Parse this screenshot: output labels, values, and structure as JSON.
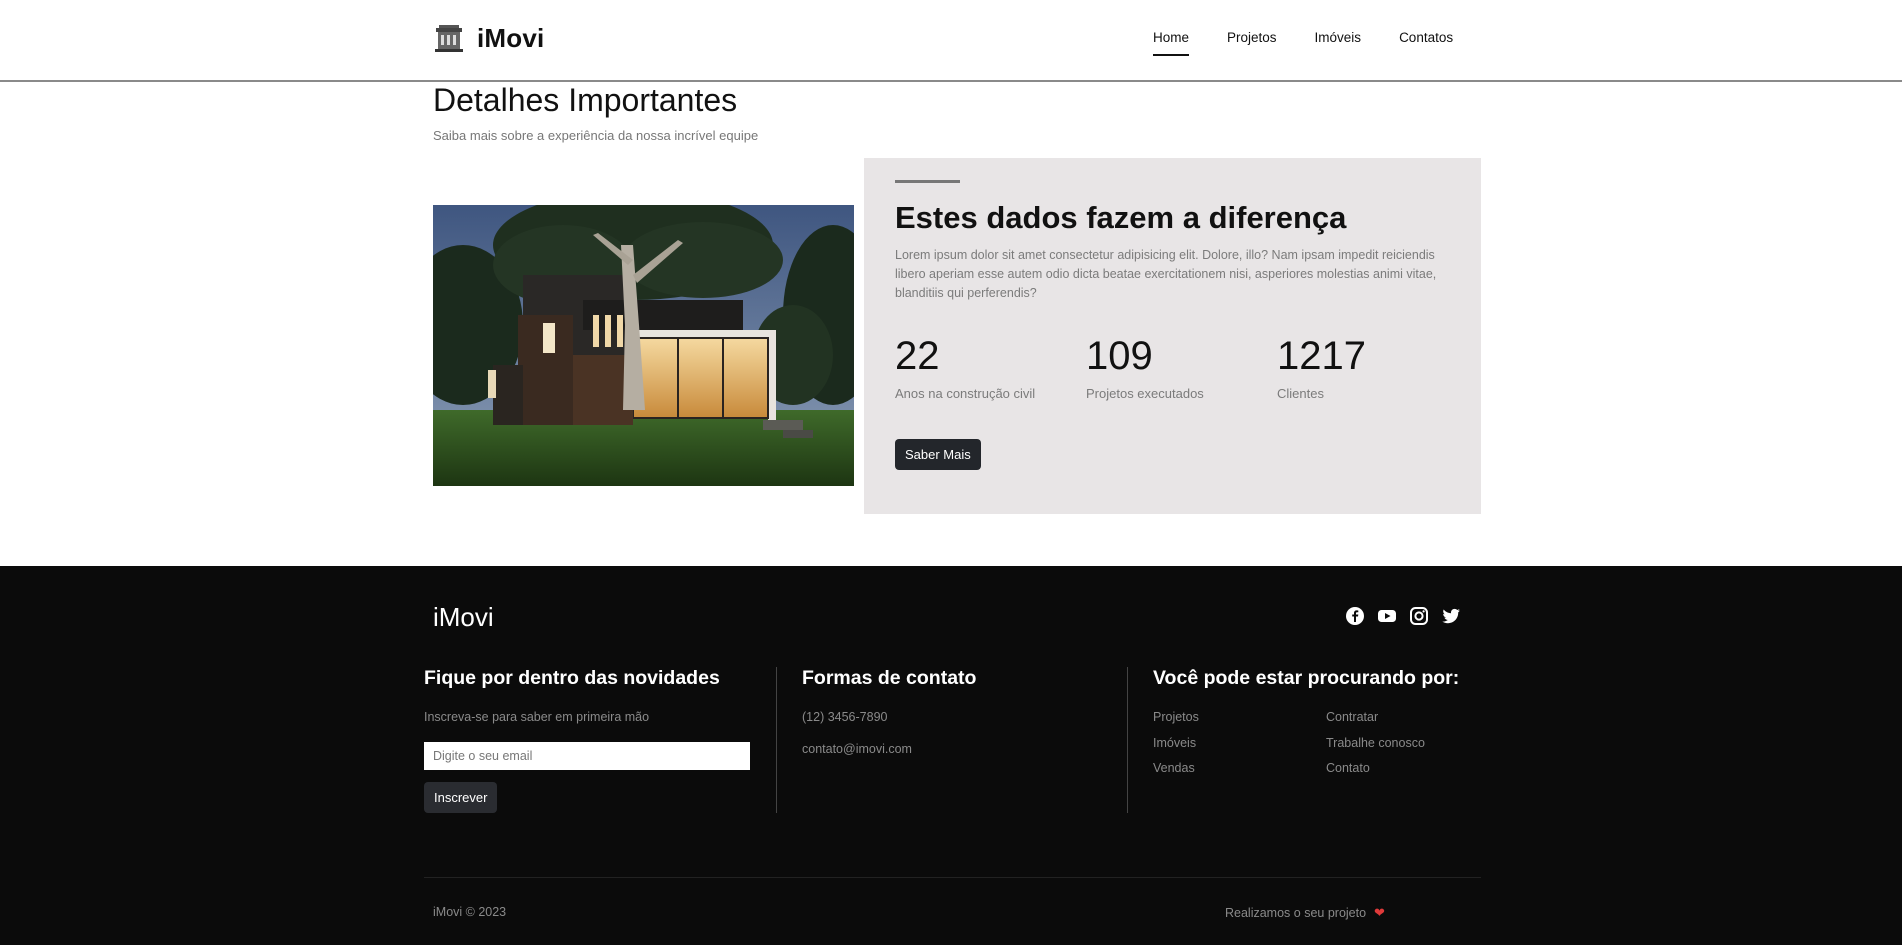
{
  "header": {
    "brand": "iMovi",
    "brand_icon": "building-icon",
    "nav": [
      {
        "label": "Home",
        "active": true
      },
      {
        "label": "Projetos",
        "active": false
      },
      {
        "label": "Imóveis",
        "active": false
      },
      {
        "label": "Contatos",
        "active": false
      }
    ]
  },
  "section": {
    "title": "Detalhes Importantes",
    "subtitle": "Saiba mais sobre a experiência da nossa incrível equipe"
  },
  "panel": {
    "title": "Estes dados fazem a diferença",
    "text": "Lorem ipsum dolor sit amet consectetur adipisicing elit. Dolore, illo? Nam ipsam impedit reiciendis libero aperiam esse autem odio dicta beatae exercitationem nisi, asperiores molestias animi vitae, blanditiis qui perferendis?",
    "stats": [
      {
        "value": "22",
        "label": "Anos na construção civil"
      },
      {
        "value": "109",
        "label": "Projetos executados"
      },
      {
        "value": "1217",
        "label": "Clientes"
      }
    ],
    "button": "Saber Mais",
    "background": "#e8e5e6"
  },
  "footer": {
    "brand": "iMovi",
    "social": [
      "facebook-icon",
      "youtube-icon",
      "instagram-icon",
      "twitter-icon"
    ],
    "newsletter": {
      "title": "Fique por dentro das novidades",
      "text": "Inscreva-se para saber em primeira mão",
      "placeholder": "Digite o seu email",
      "button": "Inscrever"
    },
    "contact": {
      "title": "Formas de contato",
      "phone": "(12) 3456-7890",
      "email": "contato@imovi.com"
    },
    "links": {
      "title": "Você pode estar procurando por:",
      "col1": [
        "Projetos",
        "Imóveis",
        "Vendas"
      ],
      "col2": [
        "Contratar",
        "Trabalhe conosco",
        "Contato"
      ]
    },
    "copyright": "iMovi © 2023",
    "tagline": "Realizamos o seu projeto"
  },
  "colors": {
    "footer_bg": "#0b0b0b",
    "button_dark": "#23262b",
    "heart": "#e03a3a"
  }
}
